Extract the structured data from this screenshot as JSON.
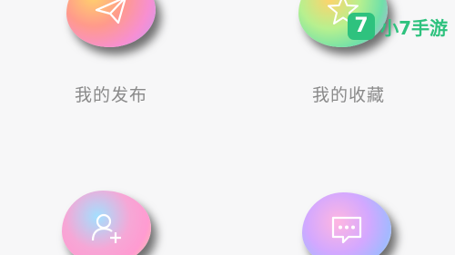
{
  "menu": {
    "items": [
      {
        "label": "我的发布",
        "icon": "paper-plane-icon"
      },
      {
        "label": "我的收藏",
        "icon": "star-icon"
      },
      {
        "label": "",
        "icon": "add-user-icon"
      },
      {
        "label": "",
        "icon": "message-icon"
      }
    ]
  },
  "watermark": {
    "badge": "7",
    "text": "小7手游"
  },
  "colors": {
    "background": "#f7f7f8",
    "label": "#8a8a8a",
    "watermark": "#2ec27e"
  }
}
